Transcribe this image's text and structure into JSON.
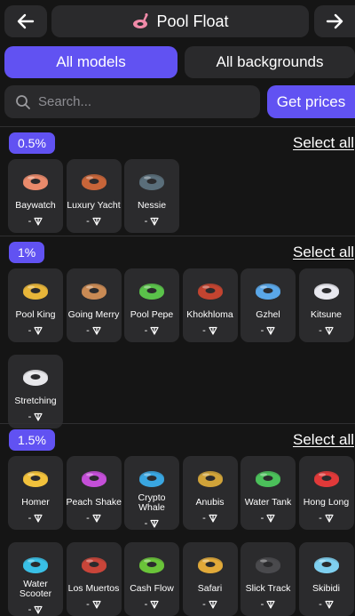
{
  "header": {
    "title": "Pool Float",
    "icon": "flamingo-float-icon"
  },
  "toggle": {
    "models_label": "All models",
    "backgrounds_label": "All backgrounds"
  },
  "search": {
    "placeholder": "Search...",
    "value": ""
  },
  "prices_label": "Get prices",
  "sections": [
    {
      "rarity": "0.5%",
      "select_all": "Select all",
      "items": [
        {
          "name": "Baywatch",
          "price": "-",
          "color": "#e98a6b"
        },
        {
          "name": "Luxury Yacht",
          "price": "-",
          "color": "#c7653a"
        },
        {
          "name": "Nessie",
          "price": "-",
          "color": "#5a6e7a"
        }
      ]
    },
    {
      "rarity": "1%",
      "select_all": "Select all",
      "items": [
        {
          "name": "Pool King",
          "price": "-",
          "color": "#e6b53a"
        },
        {
          "name": "Going Merry",
          "price": "-",
          "color": "#c98a55"
        },
        {
          "name": "Pool Pepe",
          "price": "-",
          "color": "#5bc24a"
        },
        {
          "name": "Khokhloma",
          "price": "-",
          "color": "#c24430"
        },
        {
          "name": "Gzhel",
          "price": "-",
          "color": "#5aa7e8"
        },
        {
          "name": "Kitsune",
          "price": "-",
          "color": "#e8e8ee"
        },
        {
          "name": "Stretching",
          "price": "-",
          "color": "#e6e6ea"
        }
      ]
    },
    {
      "rarity": "1.5%",
      "select_all": "Select all",
      "items": [
        {
          "name": "Homer",
          "price": "-",
          "color": "#f2c23c"
        },
        {
          "name": "Peach Shake",
          "price": "-",
          "color": "#c44fd8"
        },
        {
          "name": "Crypto Whale",
          "price": "-",
          "color": "#3aa6e0"
        },
        {
          "name": "Anubis",
          "price": "-",
          "color": "#d0a33a"
        },
        {
          "name": "Water Tank",
          "price": "-",
          "color": "#4bbf5a"
        },
        {
          "name": "Hong Long",
          "price": "-",
          "color": "#e03a3a"
        },
        {
          "name": "Water Scooter",
          "price": "-",
          "color": "#3ac0e6"
        },
        {
          "name": "Los Muertos",
          "price": "-",
          "color": "#c9453a"
        },
        {
          "name": "Cash Flow",
          "price": "-",
          "color": "#6ac43a"
        },
        {
          "name": "Safari",
          "price": "-",
          "color": "#e0a93a"
        },
        {
          "name": "Slick Track",
          "price": "-",
          "color": "#4a4a4e"
        },
        {
          "name": "Skibidi",
          "price": "-",
          "color": "#7fd0f0"
        }
      ]
    }
  ]
}
